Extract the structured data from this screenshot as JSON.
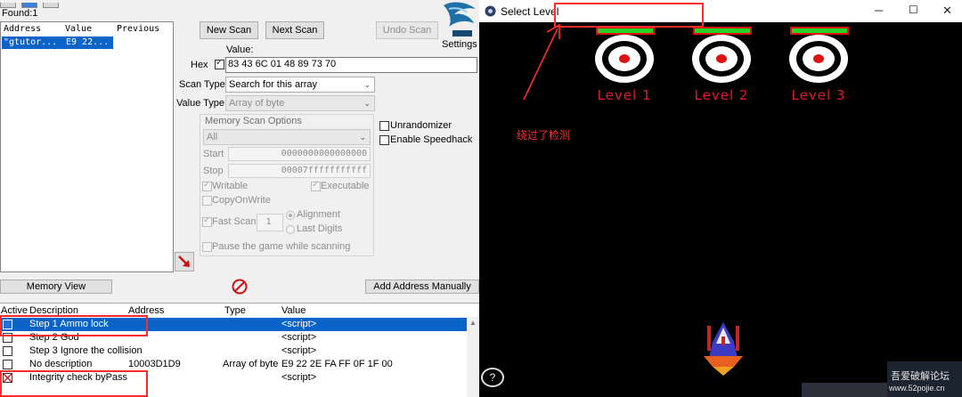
{
  "ce": {
    "found_label": "Found:1",
    "results_headers": [
      "Address",
      "Value",
      "Previous"
    ],
    "result_row": {
      "address": "\"gtutor...",
      "value": "E9 22..."
    },
    "buttons": {
      "new_scan": "New Scan",
      "next_scan": "Next Scan",
      "undo_scan": "Undo Scan",
      "memory_view": "Memory View",
      "add_address": "Add Address Manually"
    },
    "settings_label": "Settings",
    "value_label": "Value:",
    "hex_label": "Hex",
    "hex_value": "83 43 6C 01 48 89 73 70",
    "scan_type_label": "Scan Type",
    "scan_type_value": "Search for this array",
    "value_type_label": "Value Type",
    "value_type_value": "Array of byte",
    "mem_options_title": "Memory Scan Options",
    "mem_region": "All",
    "start_label": "Start",
    "start_value": "0000000000000000",
    "stop_label": "Stop",
    "stop_value": "00007fffffffffff",
    "writable_label": "Writable",
    "executable_label": "Executable",
    "copy_on_write_label": "CopyOnWrite",
    "fast_scan_label": "Fast Scan",
    "fast_scan_value": "1",
    "alignment_label": "Alignment",
    "last_digits_label": "Last Digits",
    "pause_label": "Pause the game while scanning",
    "unrandomizer_label": "Unrandomizer",
    "speedhack_label": "Enable Speedhack",
    "table_headers": {
      "active": "Active",
      "description": "Description",
      "address": "Address",
      "type": "Type",
      "value": "Value"
    },
    "table_rows": [
      {
        "description": "Step 1 Ammo lock",
        "address": "",
        "type": "",
        "value": "<script>"
      },
      {
        "description": "Step 2 God",
        "address": "",
        "type": "",
        "value": "<script>"
      },
      {
        "description": "Step 3 Ignore the collision",
        "address": "",
        "type": "",
        "value": "<script>"
      },
      {
        "description": "No description",
        "address": "10003D1D9",
        "type": "Array of byte",
        "value": "E9 22 2E FA FF 0F 1F 00"
      },
      {
        "description": "Integrity check byPass",
        "address": "",
        "type": "",
        "value": "<script>"
      }
    ]
  },
  "game": {
    "window_title": "Select Level",
    "levels": [
      "Level 1",
      "Level 2",
      "Level 3"
    ],
    "annotation": "绕过了检测",
    "help_label": "?",
    "watermark_line1": "吾爱破解论坛",
    "watermark_line2": "www.52pojie.cn"
  },
  "colors": {
    "selection": "#0a64c8",
    "level_text": "#e0182c",
    "health_bar": "#24d424",
    "annotation_red": "#ff2a2a"
  }
}
